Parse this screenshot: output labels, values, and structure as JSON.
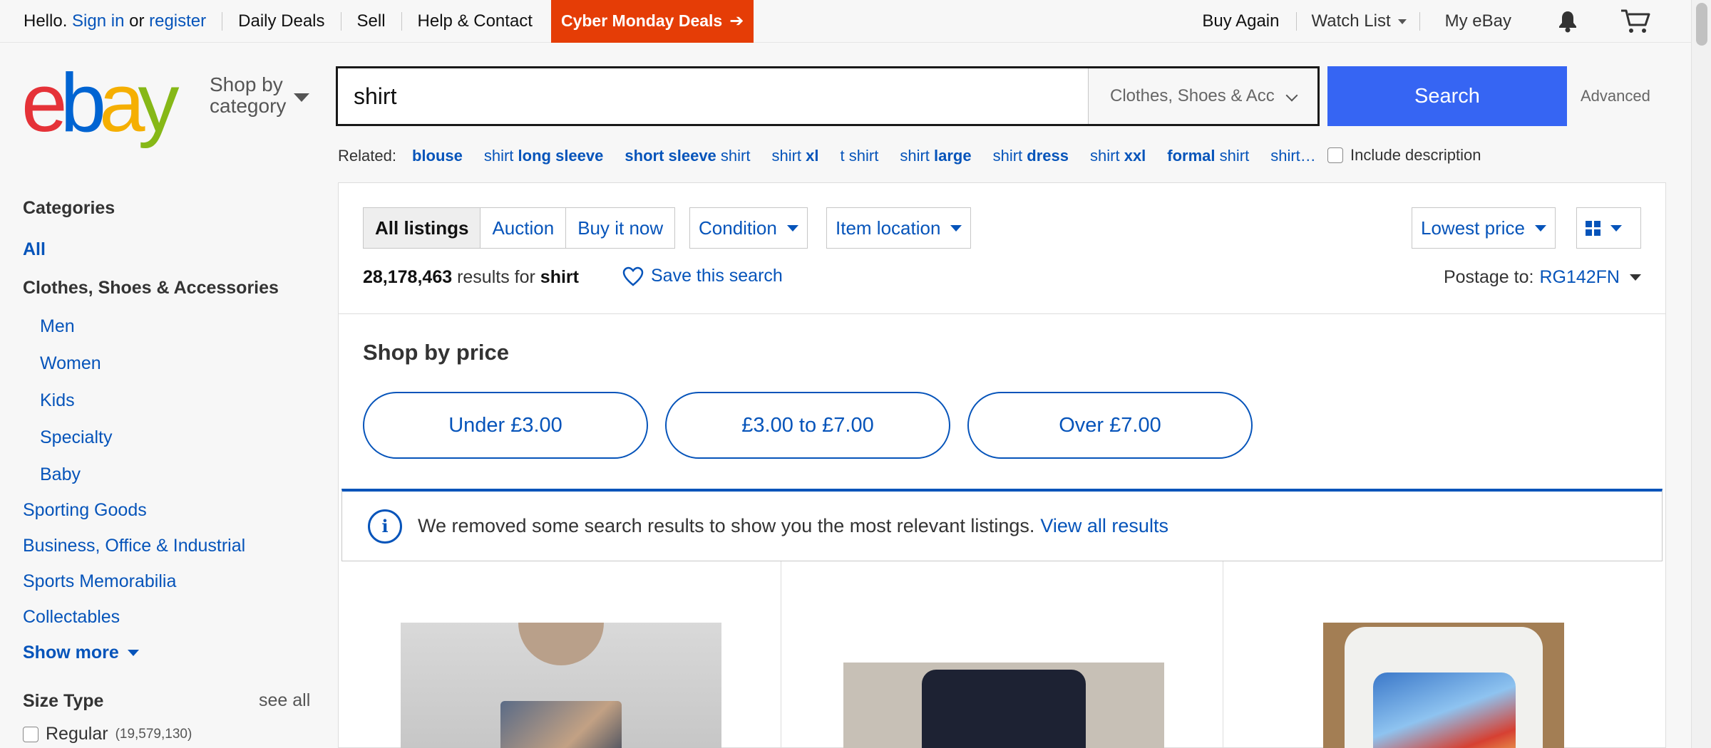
{
  "topnav": {
    "hello": "Hello.",
    "sign_in": "Sign in",
    "or": "or",
    "register": "register",
    "daily_deals": "Daily Deals",
    "sell": "Sell",
    "help_contact": "Help & Contact",
    "cyber_monday": "Cyber Monday Deals",
    "buy_again": "Buy Again",
    "watch_list": "Watch List",
    "my_ebay": "My eBay"
  },
  "header": {
    "logo_letters": [
      "e",
      "b",
      "a",
      "y"
    ],
    "logo_colors": [
      "#e53238",
      "#0064d2",
      "#f5af02",
      "#86b817"
    ],
    "shop_by_line1": "Shop by",
    "shop_by_line2": "category",
    "search_value": "shirt",
    "category_select": "Clothes, Shoes & Acc",
    "search_button": "Search",
    "advanced": "Advanced"
  },
  "related": {
    "label": "Related:",
    "include_description": "Include description"
  },
  "sidebar": {
    "categories_heading": "Categories",
    "all": "All",
    "current_category": "Clothes, Shoes & Accessories",
    "subcategories": [
      "Men",
      "Women",
      "Kids",
      "Specialty",
      "Baby"
    ],
    "top_categories": [
      "Sporting Goods",
      "Business, Office & Industrial",
      "Sports Memorabilia",
      "Collectables"
    ],
    "show_more": "Show more",
    "size_type_heading": "Size Type",
    "see_all": "see all",
    "regular_label": "Regular",
    "regular_count": "(19,579,130)"
  },
  "filters": {
    "all_listings": "All listings",
    "auction": "Auction",
    "buy_it_now": "Buy it now",
    "condition": "Condition",
    "item_location": "Item location",
    "sort": "Lowest price"
  },
  "results": {
    "count": "28,178,463",
    "results_for": "results for",
    "query": "shirt",
    "save_search": "Save this search",
    "postage_to": "Postage to:",
    "postcode": "RG142FN"
  },
  "shop_by_price": {
    "heading": "Shop by price",
    "ranges": [
      "Under £3.00",
      "£3.00 to £7.00",
      "Over £7.00"
    ]
  },
  "notice": {
    "message": "We removed some search results to show you the most relevant listings.",
    "link": "View all results"
  },
  "colors": {
    "link_blue": "#0654ba",
    "search_button": "#3665f3",
    "cyber_monday_bg": "#e53d06"
  }
}
